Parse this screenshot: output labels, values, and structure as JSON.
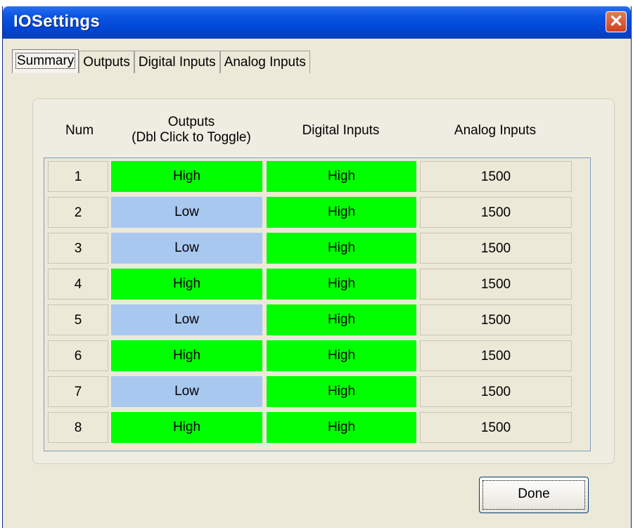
{
  "window": {
    "title": "IOSettings"
  },
  "tabs": [
    "Summary",
    "Outputs",
    "Digital Inputs",
    "Analog Inputs"
  ],
  "active_tab": "Summary",
  "headers": {
    "num": "Num",
    "outputs_line1": "Outputs",
    "outputs_line2": "(Dbl Click to Toggle)",
    "digital_inputs": "Digital Inputs",
    "analog_inputs": "Analog Inputs"
  },
  "rows": [
    {
      "num": "1",
      "output": "High",
      "digital": "High",
      "analog": "1500"
    },
    {
      "num": "2",
      "output": "Low",
      "digital": "High",
      "analog": "1500"
    },
    {
      "num": "3",
      "output": "Low",
      "digital": "High",
      "analog": "1500"
    },
    {
      "num": "4",
      "output": "High",
      "digital": "High",
      "analog": "1500"
    },
    {
      "num": "5",
      "output": "Low",
      "digital": "High",
      "analog": "1500"
    },
    {
      "num": "6",
      "output": "High",
      "digital": "High",
      "analog": "1500"
    },
    {
      "num": "7",
      "output": "Low",
      "digital": "High",
      "analog": "1500"
    },
    {
      "num": "8",
      "output": "High",
      "digital": "High",
      "analog": "1500"
    }
  ],
  "colors": {
    "high": "#00ff00",
    "low": "#a9c8f0"
  },
  "buttons": {
    "done": "Done"
  }
}
